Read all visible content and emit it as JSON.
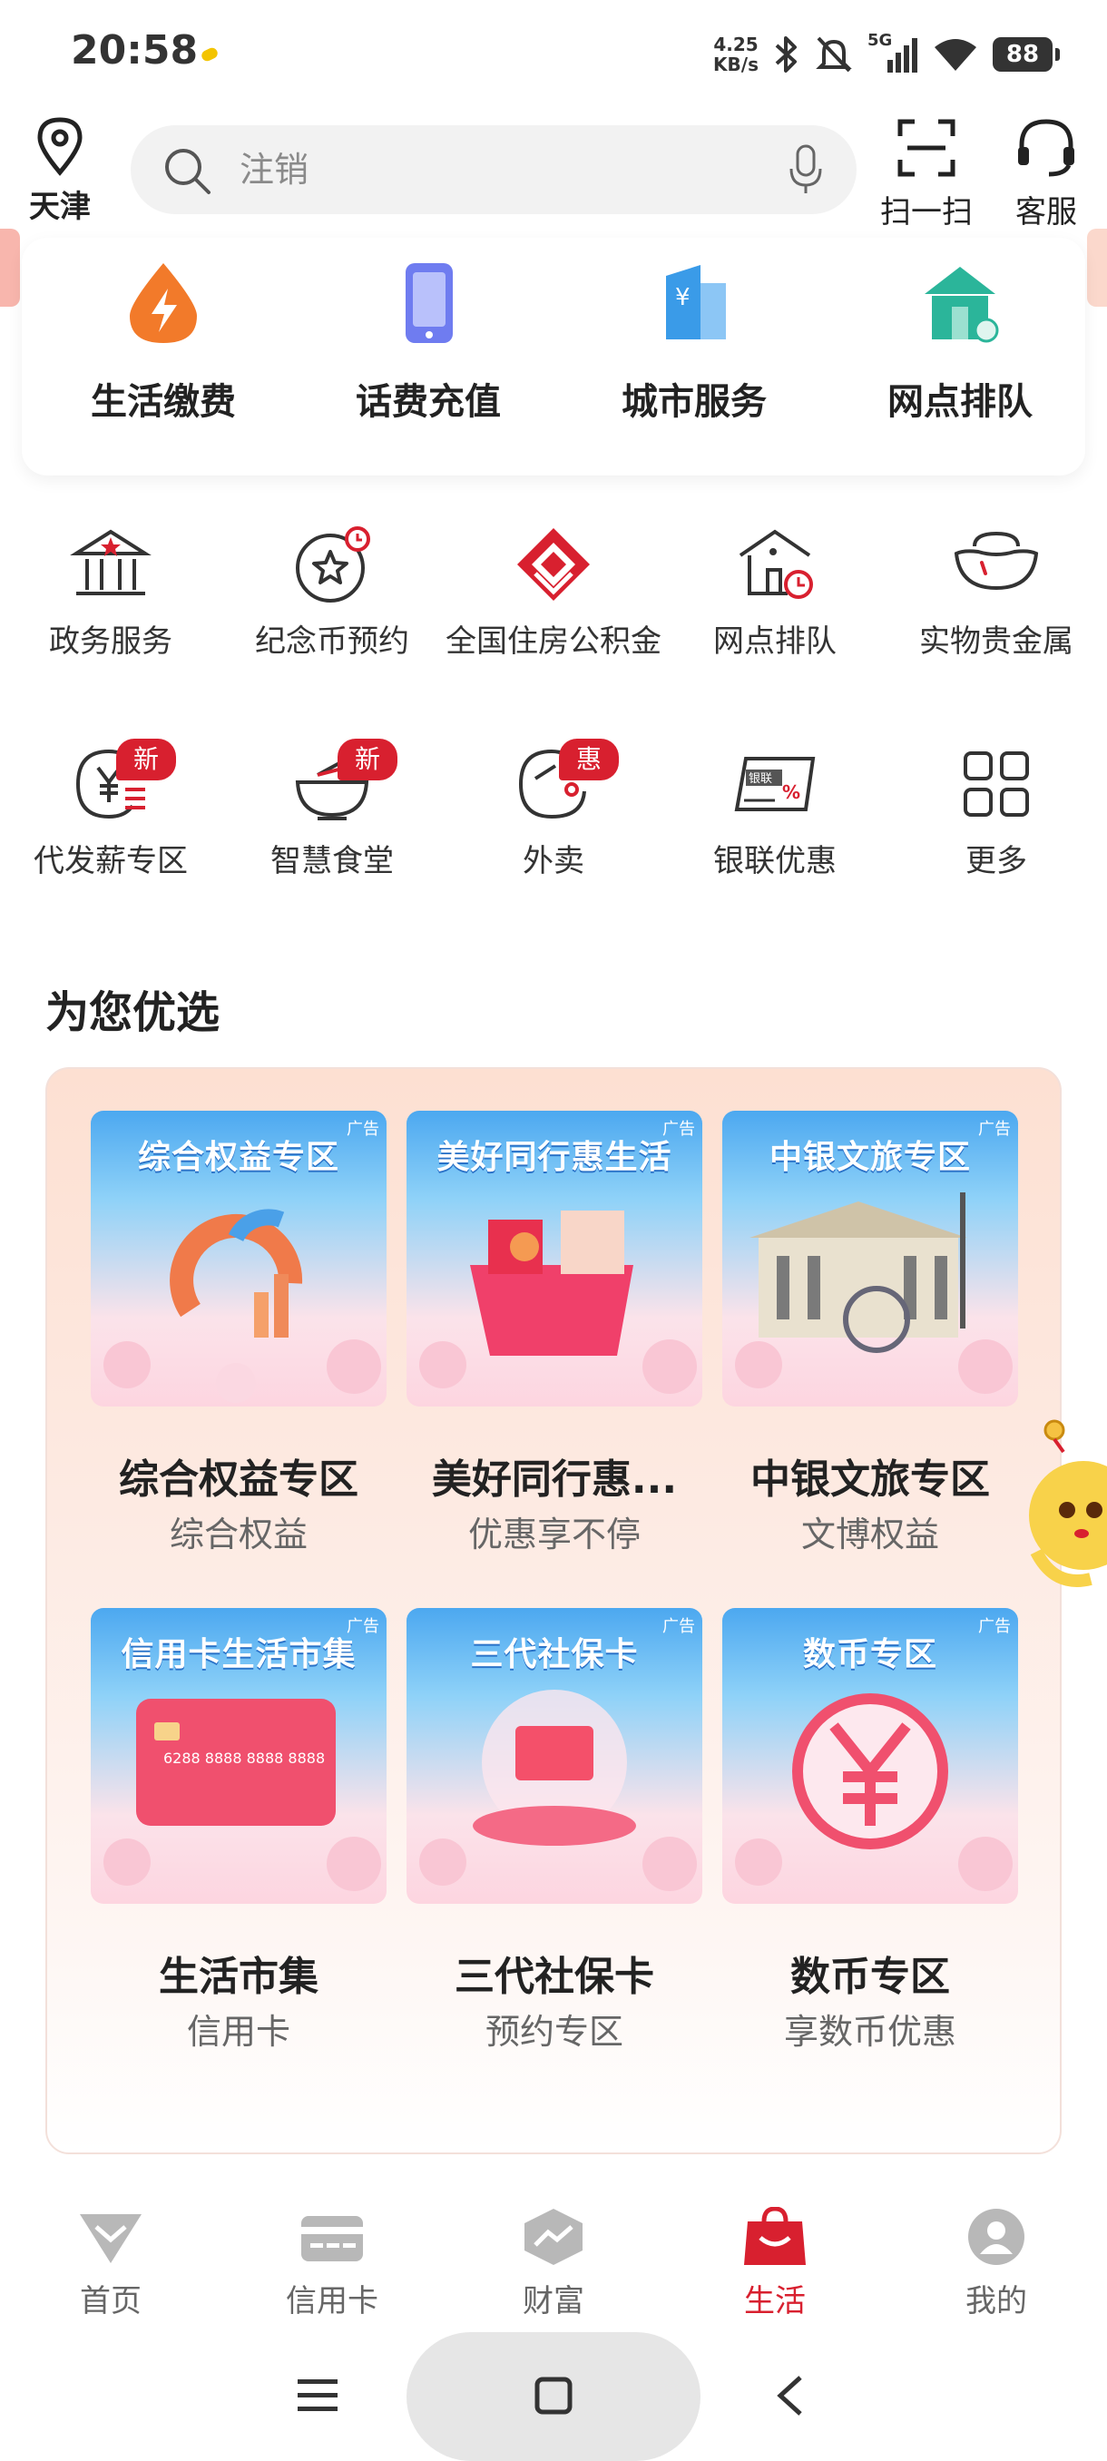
{
  "status_bar": {
    "time": "20:58",
    "net_speed_value": "4.25",
    "net_speed_unit": "KB/s",
    "signal": "5G",
    "battery": "88"
  },
  "header": {
    "location": "天津",
    "search_placeholder": "注销",
    "scan_label": "扫一扫",
    "service_label": "客服"
  },
  "quick_services": [
    {
      "label": "生活缴费",
      "icon": "lightning-icon",
      "color": "#f27a2a"
    },
    {
      "label": "话费充值",
      "icon": "phone-icon",
      "color": "#6f7cf0"
    },
    {
      "label": "城市服务",
      "icon": "city-building-icon",
      "color": "#3a9be8"
    },
    {
      "label": "网点排队",
      "icon": "bank-branch-icon",
      "color": "#2bb59a"
    }
  ],
  "services": [
    {
      "label": "政务服务",
      "icon": "government-icon"
    },
    {
      "label": "纪念币预约",
      "icon": "commemorative-coin-icon"
    },
    {
      "label": "全国住房公积金",
      "icon": "housing-fund-icon"
    },
    {
      "label": "网点排队",
      "icon": "branch-queue-icon"
    },
    {
      "label": "实物贵金属",
      "icon": "gold-ingot-icon"
    },
    {
      "label": "代发薪专区",
      "icon": "payroll-icon",
      "badge": "新"
    },
    {
      "label": "智慧食堂",
      "icon": "canteen-bowl-icon",
      "badge": "新"
    },
    {
      "label": "外卖",
      "icon": "takeout-icon",
      "badge": "惠"
    },
    {
      "label": "银联优惠",
      "icon": "unionpay-card-icon"
    },
    {
      "label": "更多",
      "icon": "more-grid-icon"
    }
  ],
  "section_title": "为您优选",
  "promotions": [
    {
      "image_title": "综合权益专区",
      "ad": "广告",
      "title": "综合权益专区",
      "subtitle": "综合权益"
    },
    {
      "image_title": "美好同行惠生活",
      "ad": "广告",
      "title": "美好同行惠...",
      "subtitle": "优惠享不停"
    },
    {
      "image_title": "中银文旅专区",
      "ad": "广告",
      "title": "中银文旅专区",
      "subtitle": "文博权益"
    },
    {
      "image_title": "信用卡生活市集",
      "ad": "广告",
      "title": "生活市集",
      "subtitle": "信用卡",
      "card_number": "6288 8888 8888 8888"
    },
    {
      "image_title": "三代社保卡",
      "ad": "广告",
      "title": "三代社保卡",
      "subtitle": "预约专区"
    },
    {
      "image_title": "数币专区",
      "ad": "广告",
      "title": "数币专区",
      "subtitle": "享数币优惠"
    }
  ],
  "bottom_nav": [
    {
      "label": "首页",
      "icon": "diamond-home-icon",
      "active": false
    },
    {
      "label": "信用卡",
      "icon": "credit-card-icon",
      "active": false
    },
    {
      "label": "财富",
      "icon": "wealth-chart-icon",
      "active": false
    },
    {
      "label": "生活",
      "icon": "shopping-bag-icon",
      "active": true
    },
    {
      "label": "我的",
      "icon": "profile-icon",
      "active": false
    }
  ],
  "colors": {
    "brand_red": "#d8202f",
    "panel_pink": "#fde0d2"
  }
}
